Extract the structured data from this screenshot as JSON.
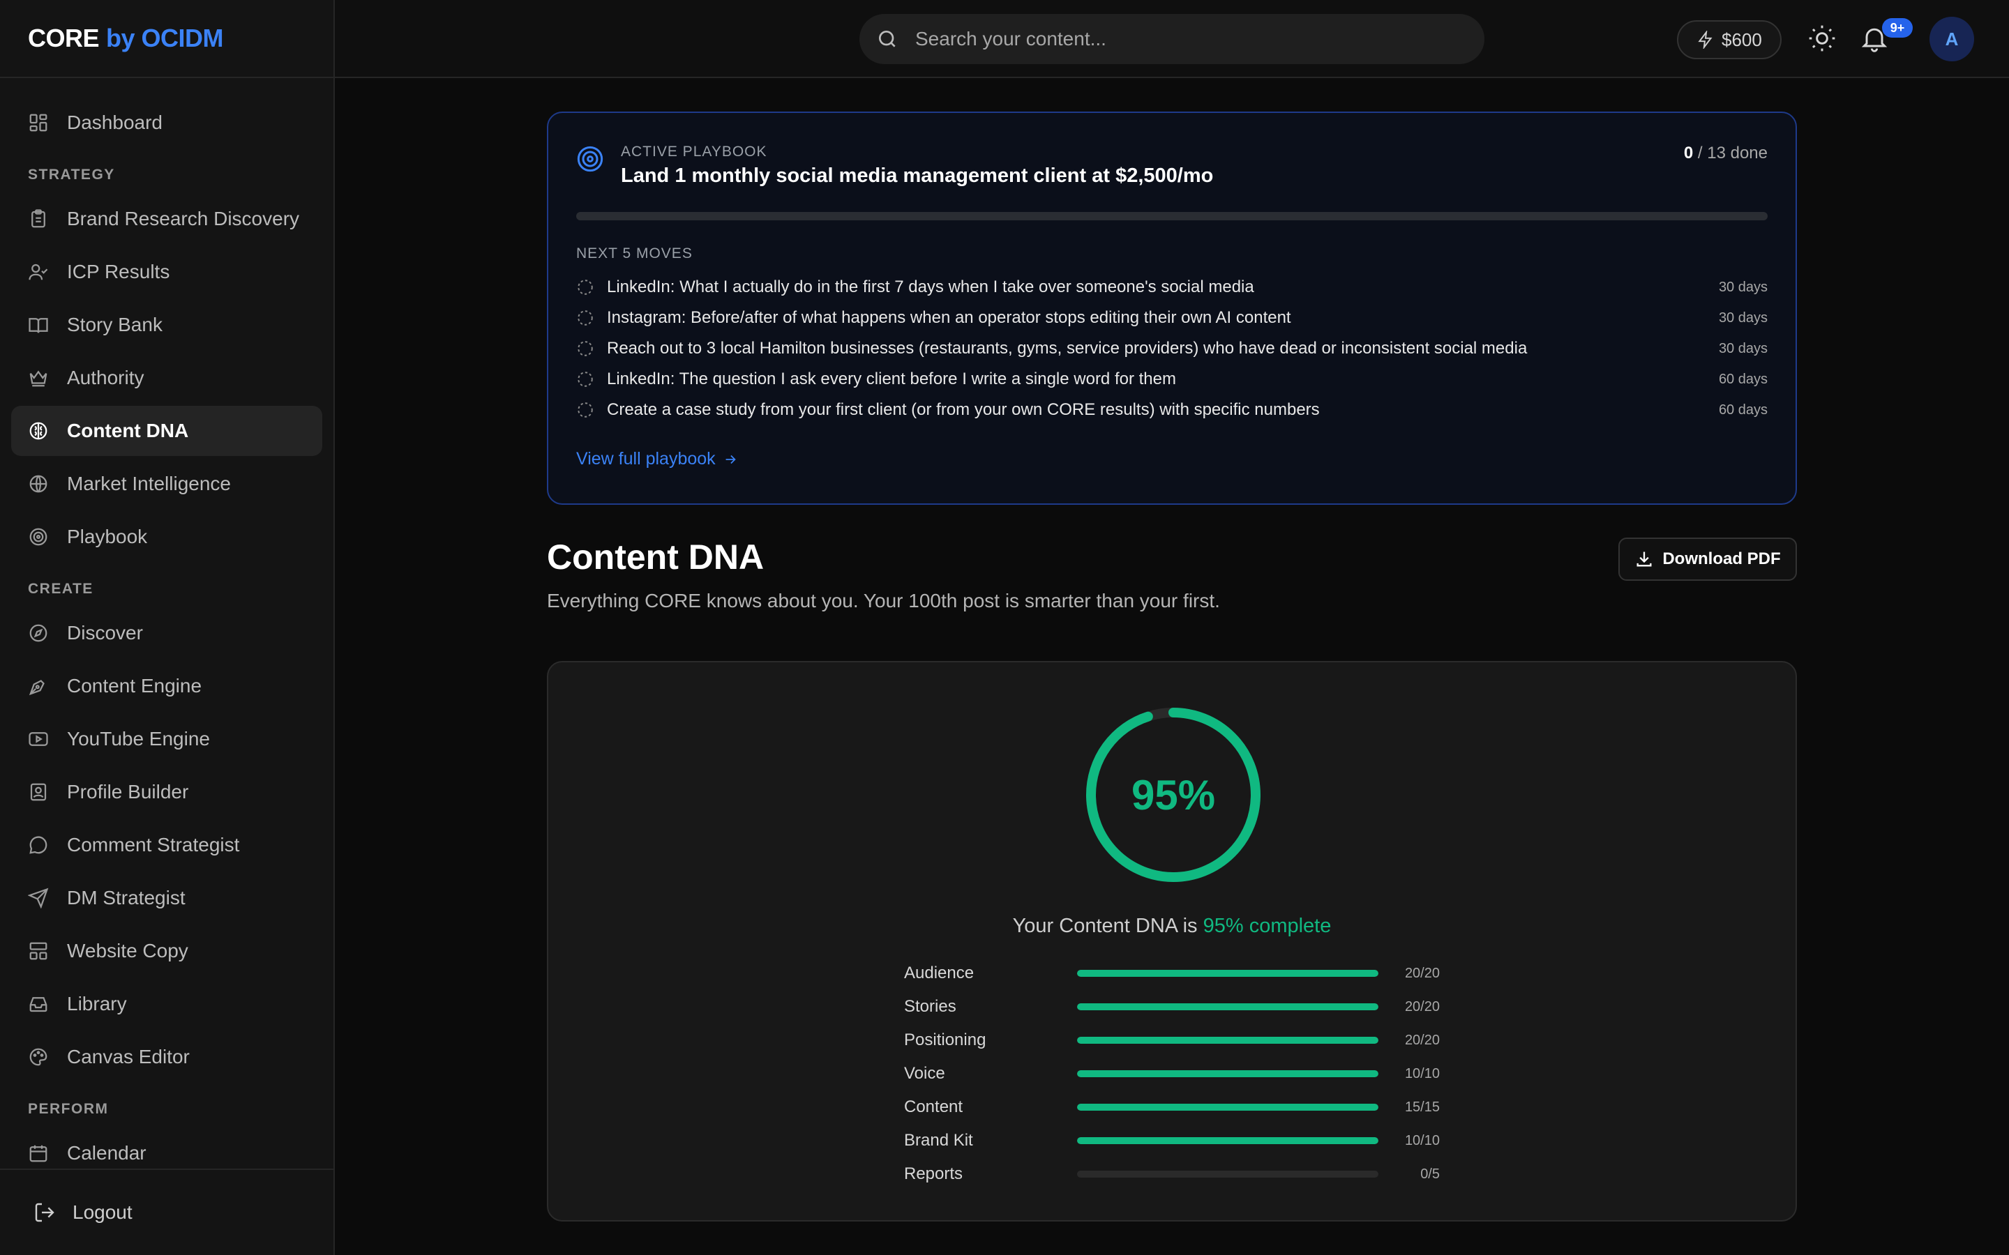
{
  "brand": {
    "name": "CORE",
    "suffix": "by OCIDM"
  },
  "sidebar": {
    "dashboard": "Dashboard",
    "sections": {
      "strategy": "STRATEGY",
      "create": "CREATE",
      "perform": "PERFORM"
    },
    "strategy_items": [
      "Brand Research Discovery",
      "ICP Results",
      "Story Bank",
      "Authority",
      "Content DNA",
      "Market Intelligence",
      "Playbook"
    ],
    "create_items": [
      "Discover",
      "Content Engine",
      "YouTube Engine",
      "Profile Builder",
      "Comment Strategist",
      "DM Strategist",
      "Website Copy",
      "Library",
      "Canvas Editor"
    ],
    "perform_items": [
      "Calendar"
    ],
    "active_item": "Content DNA",
    "logout": "Logout"
  },
  "topbar": {
    "search_placeholder": "Search your content...",
    "credits": "$600",
    "notification_badge": "9+",
    "avatar_initial": "A"
  },
  "playbook": {
    "eyebrow": "ACTIVE PLAYBOOK",
    "title": "Land 1 monthly social media management client at $2,500/mo",
    "done_count": "0",
    "total_label": "/ 13 done",
    "progress_percent": 0,
    "next_label": "NEXT 5 MOVES",
    "moves": [
      {
        "text": "LinkedIn: What I actually do in the first 7 days when I take over someone's social media",
        "due": "30 days"
      },
      {
        "text": "Instagram: Before/after of what happens when an operator stops editing their own AI content",
        "due": "30 days"
      },
      {
        "text": "Reach out to 3 local Hamilton businesses (restaurants, gyms, service providers) who have dead or inconsistent social media",
        "due": "30 days"
      },
      {
        "text": "LinkedIn: The question I ask every client before I write a single word for them",
        "due": "60 days"
      },
      {
        "text": "Create a case study from your first client (or from your own CORE results) with specific numbers",
        "due": "60 days"
      }
    ],
    "link_label": "View full playbook"
  },
  "page": {
    "title": "Content DNA",
    "subtitle": "Everything CORE knows about you. Your 100th post is smarter than your first.",
    "download_label": "Download PDF"
  },
  "dna": {
    "percent_label": "95%",
    "percent_value": 95,
    "status_prefix": "Your Content DNA is",
    "status_highlight": "95% complete",
    "accent_color": "#10b981",
    "categories": [
      {
        "name": "Audience",
        "score": "20/20",
        "fraction": 1.0
      },
      {
        "name": "Stories",
        "score": "20/20",
        "fraction": 1.0
      },
      {
        "name": "Positioning",
        "score": "20/20",
        "fraction": 1.0
      },
      {
        "name": "Voice",
        "score": "10/10",
        "fraction": 1.0
      },
      {
        "name": "Content",
        "score": "15/15",
        "fraction": 1.0
      },
      {
        "name": "Brand Kit",
        "score": "10/10",
        "fraction": 1.0
      },
      {
        "name": "Reports",
        "score": "0/5",
        "fraction": 0.0
      }
    ]
  }
}
